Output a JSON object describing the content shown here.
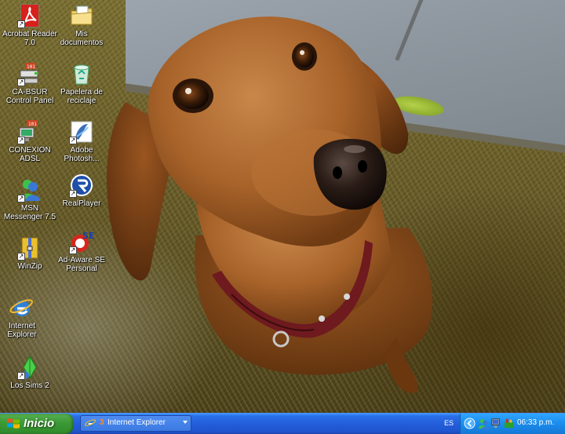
{
  "desktop": {
    "icons": [
      {
        "label": "Acrobat Reader\n7.0",
        "icon": "acrobat-reader-icon"
      },
      {
        "label": "Mis\ndocumentos",
        "icon": "my-documents-icon"
      },
      {
        "label": "CA-BSUR\nControl Panel",
        "icon": "network-control-panel-icon"
      },
      {
        "label": "Papelera de\nreciclaje",
        "icon": "recycle-bin-icon"
      },
      {
        "label": "CONEXION\nADSL",
        "icon": "adsl-connection-icon"
      },
      {
        "label": "Adobe\nPhotosh...",
        "icon": "adobe-photoshop-icon"
      },
      {
        "label": "MSN\nMessenger 7.5",
        "icon": "msn-messenger-icon"
      },
      {
        "label": "RealPlayer",
        "icon": "realplayer-icon"
      },
      {
        "label": "WinZip",
        "icon": "winzip-icon"
      },
      {
        "label": "Ad-Aware SE\nPersonal",
        "icon": "ad-aware-icon"
      },
      {
        "label": "Internet\nExplorer",
        "icon": "internet-explorer-icon"
      },
      {
        "label": "Los Sims 2",
        "icon": "sims-2-icon"
      }
    ]
  },
  "taskbar": {
    "start_label": "Inicio",
    "task_count": "3",
    "task_label": "Internet Explorer",
    "language": "ES",
    "clock": "06:33 p.m."
  },
  "colors": {
    "taskbar_blue": "#245edb",
    "start_green": "#3c9a36",
    "tray_blue": "#1b8cec"
  }
}
